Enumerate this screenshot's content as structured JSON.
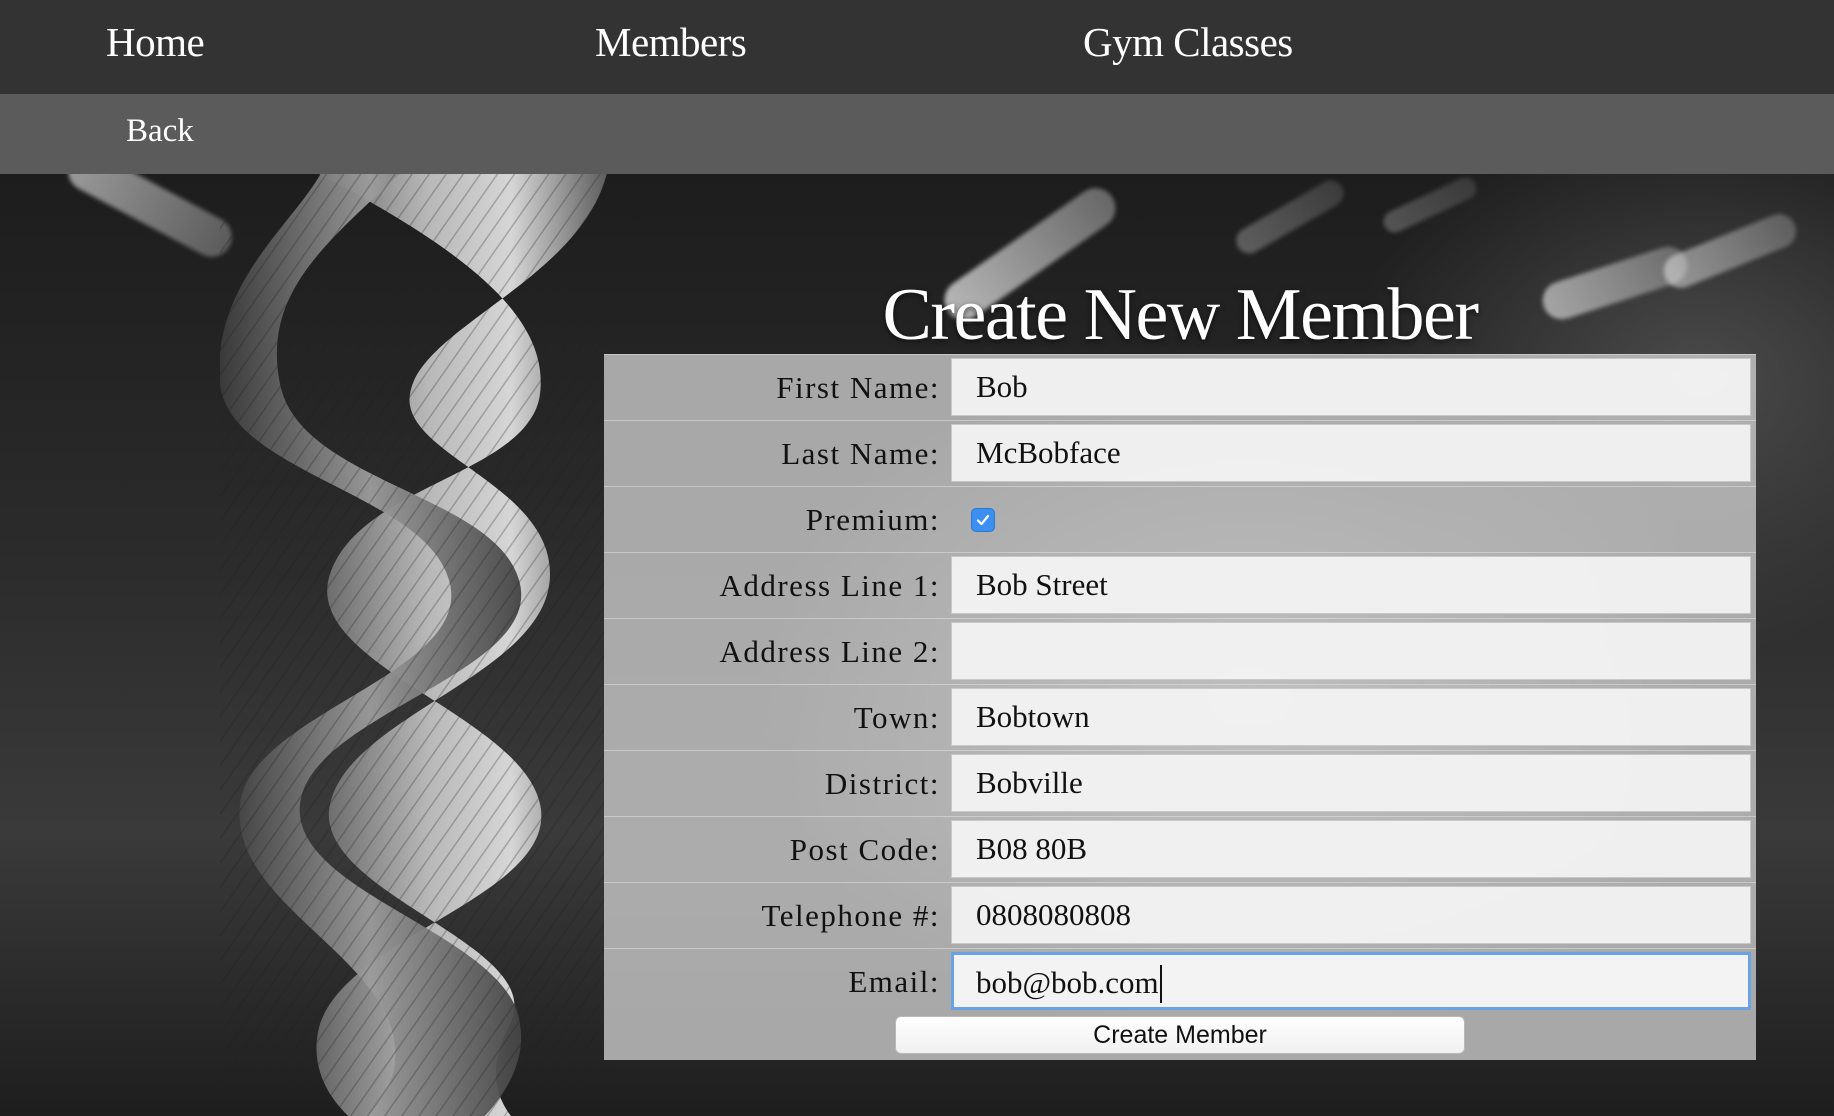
{
  "nav": {
    "home": "Home",
    "members": "Members",
    "gym_classes": "Gym Classes"
  },
  "subnav": {
    "back": "Back"
  },
  "form": {
    "title": "Create New Member",
    "fields": {
      "first_name": {
        "label": "First Name:",
        "value": "Bob"
      },
      "last_name": {
        "label": "Last Name:",
        "value": "McBobface"
      },
      "premium": {
        "label": "Premium:",
        "checked": true
      },
      "address_line_1": {
        "label": "Address Line 1:",
        "value": "Bob Street"
      },
      "address_line_2": {
        "label": "Address Line 2:",
        "value": ""
      },
      "town": {
        "label": "Town:",
        "value": "Bobtown"
      },
      "district": {
        "label": "District:",
        "value": "Bobville"
      },
      "post_code": {
        "label": "Post Code:",
        "value": "B08 80B"
      },
      "telephone": {
        "label": "Telephone #:",
        "value": "0808080808"
      },
      "email": {
        "label": "Email:",
        "value": "bob@bob.com"
      }
    },
    "submit_label": "Create Member"
  },
  "colors": {
    "nav_bg": "#333333",
    "subnav_bg": "#5b5b5b",
    "checkbox_accent": "#3b8ff0",
    "focus_ring": "#6aa3e4"
  }
}
